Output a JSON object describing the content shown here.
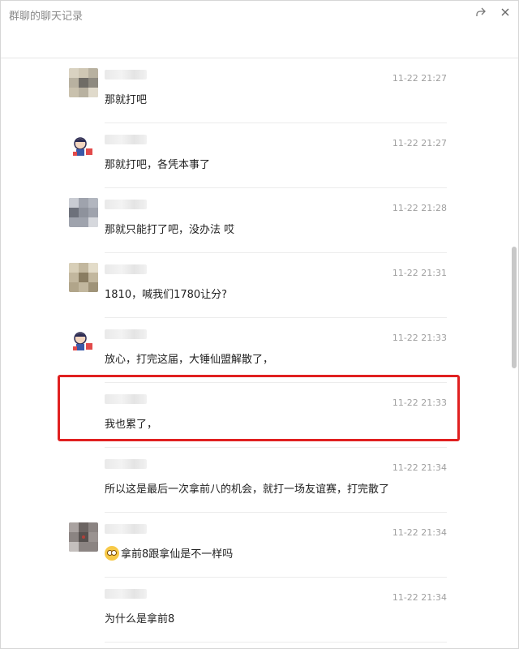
{
  "window": {
    "title": "群聊的聊天记录"
  },
  "messages": [
    {
      "time": "11-22 21:27",
      "text": "那就打吧",
      "avatar": "mosaic-1"
    },
    {
      "time": "11-22 21:27",
      "text": "那就打吧，各凭本事了",
      "avatar": "cartoon"
    },
    {
      "time": "11-22 21:28",
      "text": "那就只能打了吧，没办法 哎",
      "avatar": "mosaic-2"
    },
    {
      "time": "11-22 21:31",
      "text": "1810，喊我们1780让分?",
      "avatar": "mosaic-3"
    },
    {
      "time": "11-22 21:33",
      "text": "放心，打完这届，大锤仙盟解散了，",
      "avatar": "cartoon"
    },
    {
      "time": "11-22 21:33",
      "text": "我也累了，",
      "avatar": "none"
    },
    {
      "time": "11-22 21:34",
      "text": "所以这是最后一次拿前八的机会，就打一场友谊赛，打完散了",
      "avatar": "none"
    },
    {
      "time": "11-22 21:34",
      "text": "拿前8跟拿仙是不一样吗",
      "avatar": "mosaic-4",
      "emoji": "flushed-face-emoji"
    },
    {
      "time": "11-22 21:34",
      "text": "为什么是拿前8",
      "avatar": "none"
    }
  ],
  "highlight": {
    "color": "#e02020"
  }
}
